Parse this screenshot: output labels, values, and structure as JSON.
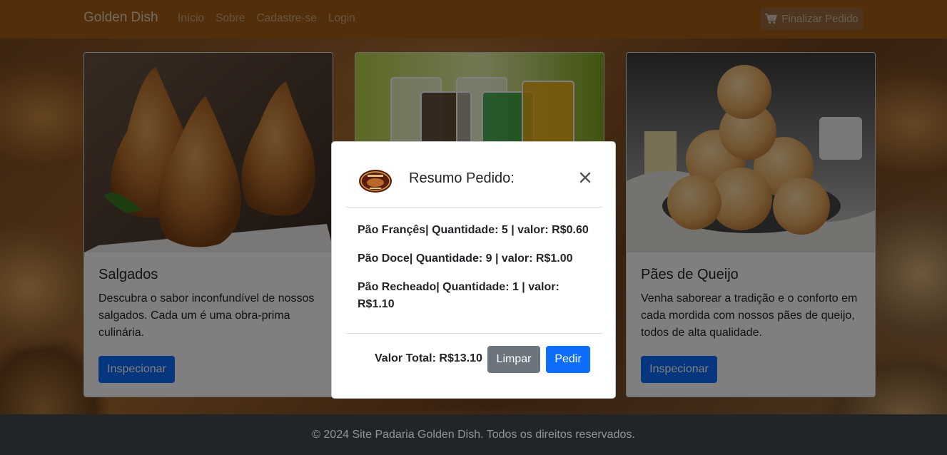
{
  "navbar": {
    "brand": "Golden Dish",
    "links": [
      "Início",
      "Sobre",
      "Cadastre-se",
      "Login"
    ],
    "checkout_label": "Finalizar Pedido",
    "checkout_icon": "cart-icon",
    "bg_color": "#a45f14"
  },
  "cards": [
    {
      "title": "Salgados",
      "text": "Descubra o sabor inconfundível de nossos salgados. Cada um é uma obra-prima culinária.",
      "button": "Inspecionar",
      "image": "coxinha-photo"
    },
    {
      "title": "",
      "text": "",
      "button": "",
      "image": "drinks-photo"
    },
    {
      "title": "Pães de Queijo",
      "text": "Venha saborear a tradição e o conforto em cada mordida com nossos pães de queijo, todos de alta qualidade.",
      "button": "Inspecionar",
      "image": "pao-de-queijo-photo"
    }
  ],
  "modal": {
    "title": "Resumo Pedido:",
    "logo": "golden-dish-logo",
    "close_icon": "close-icon",
    "items": [
      "Pão Françês| Quantidade: 5 | valor: R$0.60",
      "Pão Doce| Quantidade: 9 | valor: R$1.00",
      "Pão Recheado| Quantidade: 1 | valor: R$1.10"
    ],
    "total": "Valor Total: R$13.10",
    "clear_label": "Limpar",
    "order_label": "Pedir"
  },
  "footer": {
    "text": "© 2024 Site Padaria Golden Dish. Todos os direitos reservados."
  },
  "colors": {
    "primary": "#0d6efd",
    "secondary": "#6c757d",
    "footer_bg": "#212529"
  }
}
